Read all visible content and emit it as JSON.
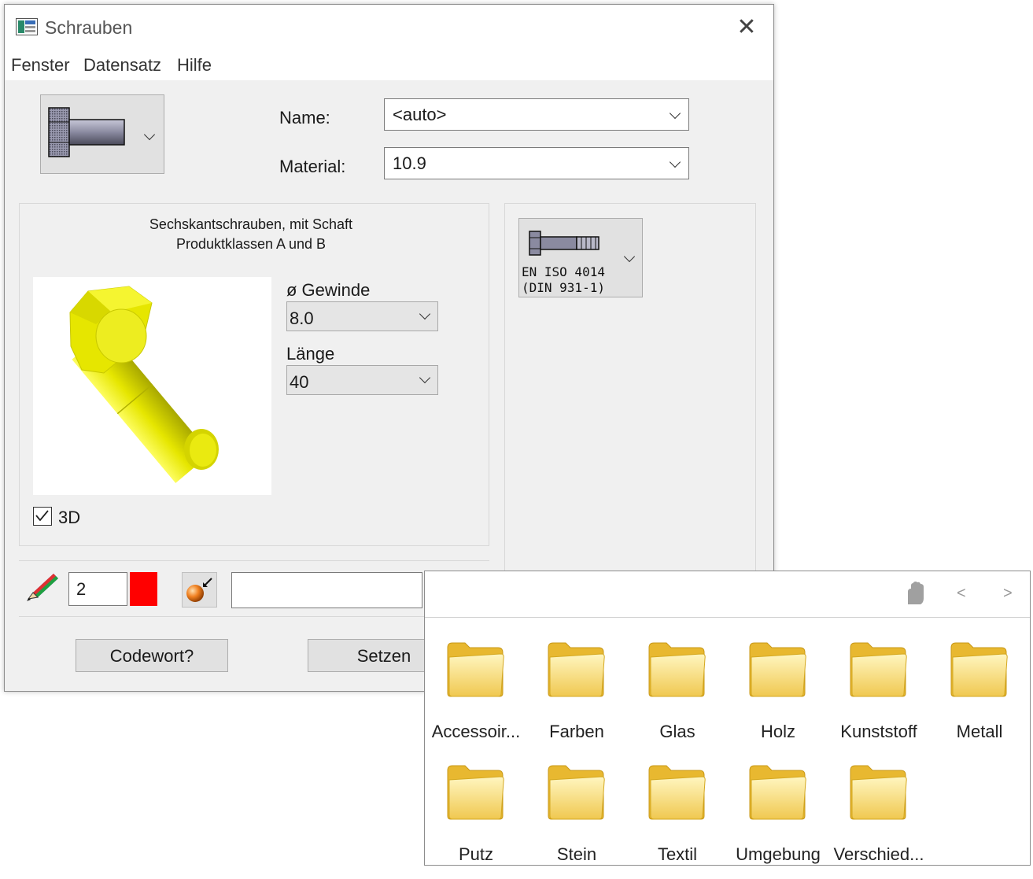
{
  "window": {
    "title": "Schrauben",
    "close_glyph": "✕"
  },
  "menu": [
    "Fenster",
    "Datensatz",
    "Hilfe"
  ],
  "form": {
    "name_label": "Name:",
    "name_value": "<auto>",
    "material_label": "Material:",
    "material_value": "10.9"
  },
  "preview": {
    "description_line1": "Sechskantschrauben, mit Schaft",
    "description_line2": "Produktklassen A und B",
    "diameter_label": "ø Gewinde",
    "diameter_value": "8.0",
    "length_label": "Länge",
    "length_value": "40",
    "checkbox_3d_label": "3D",
    "checkbox_3d_checked": true,
    "bolt_color": "#e6e600"
  },
  "standard": {
    "line1": "EN ISO 4014",
    "line2": "(DIN 931-1)"
  },
  "bottom": {
    "pen_width": "2",
    "pen_color": "#ff0000",
    "extra_value": "",
    "codeword_button": "Codewort?",
    "set_button": "Setzen"
  },
  "folders": {
    "nav_prev": "<",
    "nav_next": ">",
    "items": [
      "Accessoir...",
      "Farben",
      "Glas",
      "Holz",
      "Kunststoff",
      "Metall",
      "Putz",
      "Stein",
      "Textil",
      "Umgebung",
      "Verschied..."
    ]
  }
}
